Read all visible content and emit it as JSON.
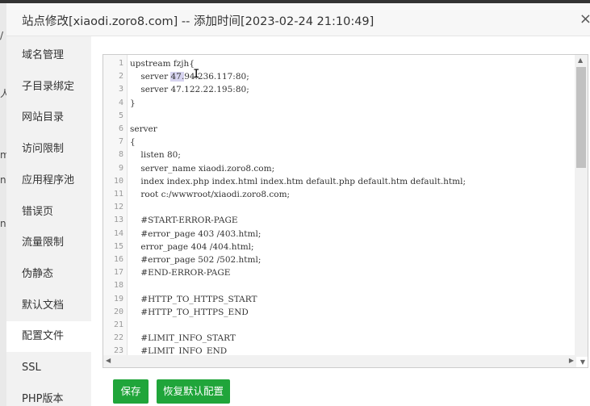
{
  "window": {
    "title": "站点修改[xiaodi.zoro8.com] -- 添加时间[2023-02-24 21:10:49]",
    "close_glyph": "×"
  },
  "background_fragments": [
    "/",
    "人",
    "m",
    "n",
    "n"
  ],
  "sidebar": {
    "items": [
      {
        "label": "域名管理"
      },
      {
        "label": "子目录绑定"
      },
      {
        "label": "网站目录"
      },
      {
        "label": "访问限制"
      },
      {
        "label": "应用程序池"
      },
      {
        "label": "错误页"
      },
      {
        "label": "流量限制"
      },
      {
        "label": "伪静态"
      },
      {
        "label": "默认文档"
      },
      {
        "label": "配置文件"
      },
      {
        "label": "SSL"
      },
      {
        "label": "PHP版本"
      }
    ],
    "active_index": 9
  },
  "editor": {
    "line_numbers": [
      "1",
      "2",
      "3",
      "4",
      "5",
      "6",
      "7",
      "8",
      "9",
      "10",
      "11",
      "12",
      "13",
      "14",
      "15",
      "16",
      "17",
      "18",
      "19",
      "20",
      "21",
      "22",
      "23"
    ],
    "lines": [
      "upstream fzjh{",
      "    server 47.94.236.117:80;",
      "    server 47.122.22.195:80;",
      "}",
      "",
      "server",
      "{",
      "    listen 80;",
      "    server_name xiaodi.zoro8.com;",
      "    index index.php index.html index.htm default.php default.htm default.html;",
      "    root c:/wwwroot/xiaodi.zoro8.com;",
      "",
      "    #START-ERROR-PAGE",
      "    #error_page 403 /403.html;",
      "    error_page 404 /404.html;",
      "    #error_page 502 /502.html;",
      "    #END-ERROR-PAGE",
      "",
      "    #HTTP_TO_HTTPS_START",
      "    #HTTP_TO_HTTPS_END",
      "",
      "    #LIMIT_INFO_START",
      "    #LIMIT_INFO_END"
    ],
    "selected_text": "47.",
    "cursor_glyph": "I",
    "scroll_glyphs": {
      "up": "▲",
      "down": "▼",
      "left": "◀",
      "right": "▶"
    }
  },
  "buttons": {
    "save": "保存",
    "restore": "恢复默认配置"
  },
  "colors": {
    "accent_green": "#20a53a",
    "sidebar_bg": "#f2f2f2",
    "header_bg": "#f7f7f7",
    "selection": "#d7d4f0"
  }
}
